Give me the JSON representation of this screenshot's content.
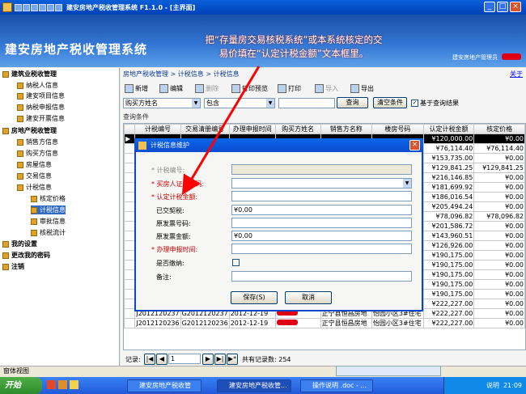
{
  "window": {
    "title": "建安房地产税收管理系统  F1.1.0 - [主界面]",
    "minimize": "_",
    "maximize": "□",
    "close": "×"
  },
  "header": {
    "app_title": "建安房地产税收管理系统",
    "user_info": "建安房地产管理员"
  },
  "annotation": {
    "line1": "把“存量房交易核税系统”或本系统核定的交",
    "line2": "易价填在“认定计税金额”文本框里。"
  },
  "breadcrumb": "房地产税收管理 > 计税信息 > 计税信息",
  "about": "关于",
  "sidebar": {
    "items": [
      {
        "label": "建筑业税收管理"
      },
      {
        "label": "纳税人信息"
      },
      {
        "label": "建安项目信息"
      },
      {
        "label": "纳税申报信息"
      },
      {
        "label": "建安开票信息"
      },
      {
        "label": "房地产税收管理"
      },
      {
        "label": "销售方信息"
      },
      {
        "label": "购买方信息"
      },
      {
        "label": "房屋信息"
      },
      {
        "label": "交易信息"
      },
      {
        "label": "计税信息"
      },
      {
        "label": "核定价格"
      },
      {
        "label": "计税信息"
      },
      {
        "label": "审批信息"
      },
      {
        "label": "核税流计"
      },
      {
        "label": "我的设置"
      },
      {
        "label": "更改我的密码"
      },
      {
        "label": "注销"
      }
    ]
  },
  "toolbar": {
    "new": "新增",
    "edit": "编辑",
    "delete": "删除",
    "print_preview": "打印预览",
    "print": "打印",
    "import": "导入",
    "export": "导出"
  },
  "query": {
    "field": "购买方姓名",
    "op": "包含",
    "value": "",
    "query_button": "查询",
    "clear_button": "清空条件",
    "based_on_result": "基于查询结果",
    "conditions_label": "查询条件"
  },
  "grid": {
    "columns": [
      "计税编号",
      "交易清册编号",
      "办理申报时间",
      "购买方姓名",
      "销售方名称",
      "楼房号码",
      "认定计税金额",
      "核定价格"
    ],
    "rows_top": [
      {
        "amount": "¥120,000.00",
        "price": "¥0.00"
      },
      {
        "amount": "¥76,114.40",
        "price": "¥76,114.40"
      },
      {
        "amount": "¥153,735.00",
        "price": "¥0.00"
      },
      {
        "amount": "¥129,841.25",
        "price": "¥129,841.25"
      },
      {
        "amount": "¥216,146.85",
        "price": "¥0.00"
      },
      {
        "amount": "¥181,699.92",
        "price": "¥0.00"
      },
      {
        "amount": "¥186,016.54",
        "price": "¥0.00"
      },
      {
        "amount": "¥205,494.24",
        "price": "¥0.00"
      },
      {
        "amount": "¥78,096.82",
        "price": "¥78,096.82"
      },
      {
        "amount": "¥201,586.72",
        "price": "¥0.00"
      },
      {
        "amount": "¥143,960.51",
        "price": "¥0.00"
      },
      {
        "amount": "¥126,926.00",
        "price": "¥0.00"
      },
      {
        "amount": "¥190,175.00",
        "price": "¥0.00"
      },
      {
        "amount": "¥190,175.00",
        "price": "¥0.00"
      },
      {
        "amount": "¥190,175.00",
        "price": "¥0.00"
      },
      {
        "amount": "¥190,175.00",
        "price": "¥0.00"
      }
    ],
    "rows_bottom": [
      {
        "id": "J2012120239",
        "trade": "G2012120239",
        "date": "2012-12-19",
        "seller": "正宁县恒昌房地",
        "house": "怡园小区3#住宅",
        "amount": "¥190,175.00",
        "price": "¥0.00"
      },
      {
        "id": "J2012120238",
        "trade": "G2012120238",
        "date": "2012-12-19",
        "seller": "正宁县恒昌房地",
        "house": "怡园小区3#住宅",
        "amount": "¥222,227.00",
        "price": "¥0.00"
      },
      {
        "id": "J2012120237",
        "trade": "G2012120237",
        "date": "2012-12-19",
        "seller": "正宁县恒昌房地",
        "house": "怡园小区3#住宅",
        "amount": "¥222,227.00",
        "price": "¥0.00"
      },
      {
        "id": "J2012120236",
        "trade": "G2012120236",
        "date": "2012-12-19",
        "seller": "正宁县恒昌房地",
        "house": "怡园小区3#住宅",
        "amount": "¥222,227.00",
        "price": "¥0.00"
      }
    ]
  },
  "pager": {
    "records_label": "记录:",
    "page": "1",
    "total": "共有记录数: 254"
  },
  "status": "窗体视图",
  "taskbar": {
    "start": "开始",
    "tasks": [
      "建安房地产税收管",
      "建安房地产税收管...",
      "操作说明 .doc - ..."
    ],
    "clock": "21:09",
    "tray_label": "说明"
  },
  "dialog": {
    "title": "计税信息维护",
    "fields": [
      {
        "label": "* 计税编号:",
        "value": ""
      },
      {
        "label": "* 买房人证件号码:",
        "value": ""
      },
      {
        "label": "* 认定计税金额:",
        "value": ""
      },
      {
        "label": "已交契税:",
        "value": "¥0.00"
      },
      {
        "label": "原发票号码:",
        "value": ""
      },
      {
        "label": "原发票金额:",
        "value": "¥0.00"
      },
      {
        "label": "* 办理申报时间:",
        "value": ""
      },
      {
        "label": "是否缴纳:",
        "value": ""
      },
      {
        "label": "备注:",
        "value": ""
      }
    ],
    "save": "保存(S)",
    "cancel": "取消",
    "close": "×"
  },
  "colors": {
    "header": "#3579d6",
    "required": "#cc0000",
    "arrow": "#ff0000",
    "mask": "#e00014"
  }
}
